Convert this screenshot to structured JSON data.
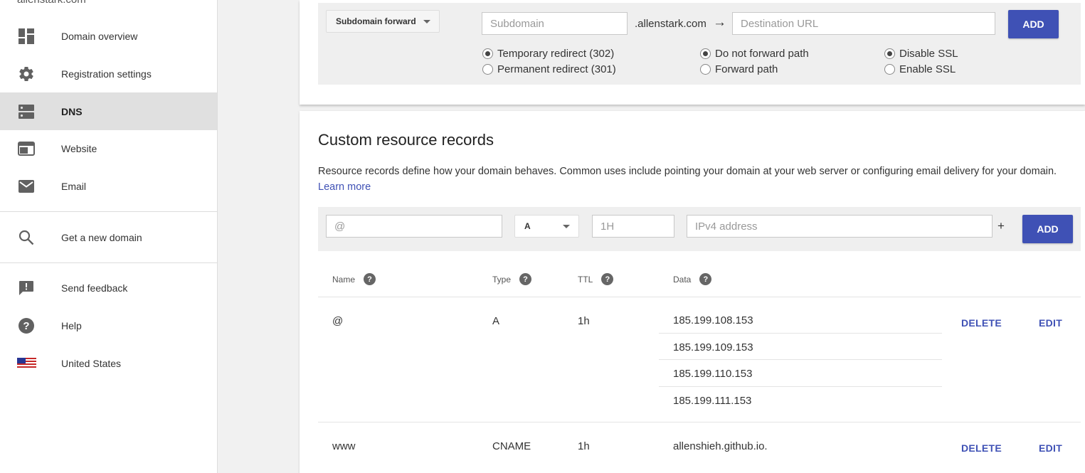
{
  "sidebar": {
    "domain": "allenstark.com",
    "items": [
      {
        "label": "Domain overview"
      },
      {
        "label": "Registration settings"
      },
      {
        "label": "DNS"
      },
      {
        "label": "Website"
      },
      {
        "label": "Email"
      },
      {
        "label": "Get a new domain"
      },
      {
        "label": "Send feedback"
      },
      {
        "label": "Help"
      },
      {
        "label": "United States"
      }
    ]
  },
  "forward": {
    "type_label": "Subdomain forward",
    "subdomain_placeholder": "Subdomain",
    "domain_suffix": ".allenstark.com",
    "arrow": "→",
    "destination_placeholder": "Destination URL",
    "add_label": "ADD",
    "redirect_options": [
      "Temporary redirect (302)",
      "Permanent redirect (301)"
    ],
    "path_options": [
      "Do not forward path",
      "Forward path"
    ],
    "ssl_options": [
      "Disable SSL",
      "Enable SSL"
    ]
  },
  "records": {
    "title": "Custom resource records",
    "description": "Resource records define how your domain behaves. Common uses include pointing your domain at your web server or configuring email delivery for your domain.",
    "learn_more": "Learn more",
    "name_placeholder": "@",
    "type_value": "A",
    "ttl_placeholder": "1H",
    "data_placeholder": "IPv4 address",
    "plus": "+",
    "add_label": "ADD",
    "headers": {
      "name": "Name",
      "type": "Type",
      "ttl": "TTL",
      "data": "Data"
    },
    "rows": [
      {
        "name": "@",
        "type": "A",
        "ttl": "1h",
        "data": [
          "185.199.108.153",
          "185.199.109.153",
          "185.199.110.153",
          "185.199.111.153"
        ]
      },
      {
        "name": "www",
        "type": "CNAME",
        "ttl": "1h",
        "data": [
          "allenshieh.github.io."
        ]
      }
    ],
    "delete_label": "DELETE",
    "edit_label": "EDIT"
  }
}
